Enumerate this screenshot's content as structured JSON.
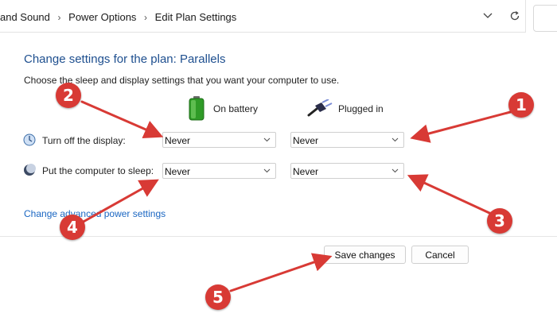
{
  "breadcrumb": {
    "items": [
      "and Sound",
      "Power Options",
      "Edit Plan Settings"
    ]
  },
  "page": {
    "title": "Change settings for the plan: Parallels",
    "subtitle": "Choose the sleep and display settings that you want your computer to use."
  },
  "columns": {
    "battery": "On battery",
    "plugged": "Plugged in"
  },
  "rows": [
    {
      "label": "Turn off the display:",
      "battery_value": "Never",
      "plugged_value": "Never"
    },
    {
      "label": "Put the computer to sleep:",
      "battery_value": "Never",
      "plugged_value": "Never"
    }
  ],
  "advanced_link": "Change advanced power settings",
  "buttons": {
    "save": "Save changes",
    "cancel": "Cancel"
  },
  "annotations": [
    "1",
    "2",
    "3",
    "4",
    "5"
  ],
  "colors": {
    "heading": "#1e4f8f",
    "link": "#1a66c2",
    "annotation_red": "#d83a35"
  },
  "icons": {
    "battery": "battery-icon",
    "plug": "plug-icon",
    "display": "display-icon",
    "sleep": "sleep-icon"
  }
}
